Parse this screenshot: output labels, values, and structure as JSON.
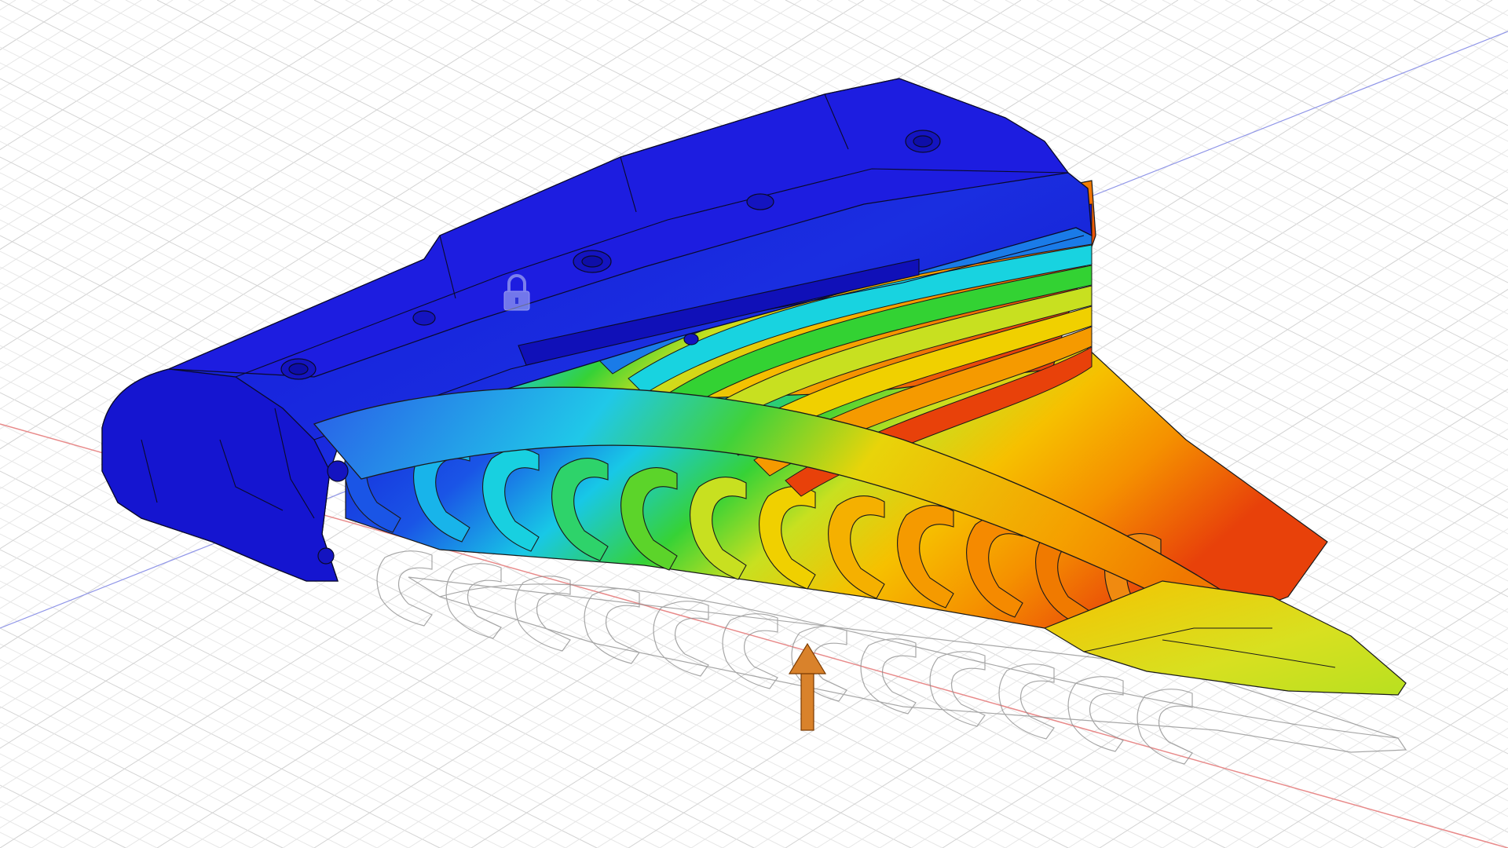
{
  "viewport": {
    "background": "#ffffff",
    "grid_minor_color": "#e6e6e6",
    "grid_major_color": "#d2d2d2",
    "axis_x_color": "#e88a8a",
    "axis_y_color": "#8f95e8"
  },
  "model": {
    "fixed_constraint_icon": "lock-icon",
    "load_icon": "arrow-up-icon",
    "load_color": "#d9822b",
    "contour_colors": [
      "#1515d8",
      "#1a7be8",
      "#18d3e0",
      "#33d233",
      "#c8e020",
      "#f0d000",
      "#f59a00",
      "#e8410a"
    ]
  }
}
